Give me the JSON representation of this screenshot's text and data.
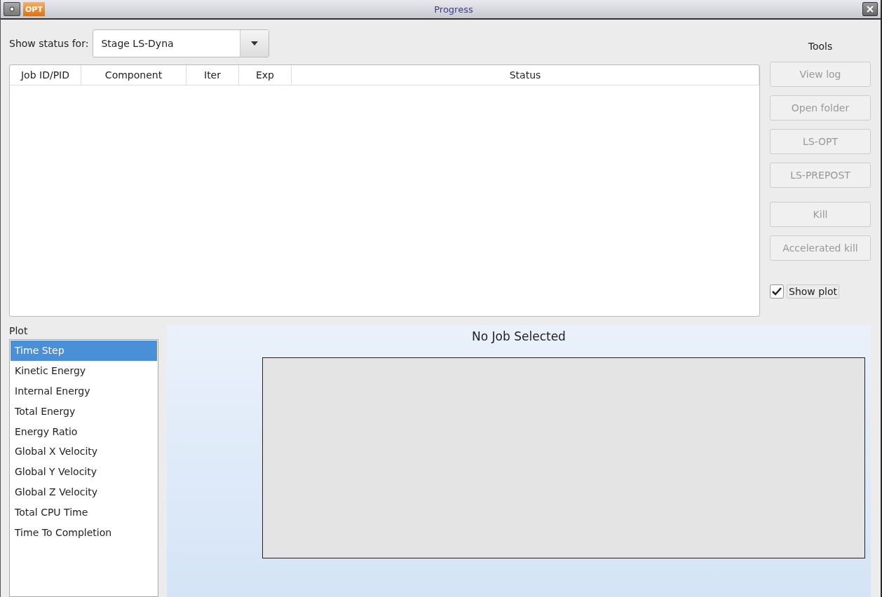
{
  "window": {
    "title": "Progress",
    "logo": "OPT"
  },
  "status_for": {
    "label": "Show status for:",
    "value": "Stage LS-Dyna"
  },
  "table": {
    "columns": [
      "Job ID/PID",
      "Component",
      "Iter",
      "Exp",
      "Status"
    ]
  },
  "tools": {
    "title": "Tools",
    "buttons": [
      {
        "label": "View log",
        "disabled": true
      },
      {
        "label": "Open folder",
        "disabled": true
      },
      {
        "label": "LS-OPT",
        "disabled": true
      },
      {
        "label": "LS-PREPOST",
        "disabled": true
      }
    ],
    "kill_buttons": [
      {
        "label": "Kill",
        "disabled": true
      },
      {
        "label": "Accelerated kill",
        "disabled": true
      }
    ],
    "show_plot": {
      "label": "Show plot",
      "checked": true
    }
  },
  "plot": {
    "label": "Plot",
    "items": [
      {
        "label": "Time Step",
        "selected": true
      },
      {
        "label": "Kinetic Energy",
        "selected": false
      },
      {
        "label": "Internal Energy",
        "selected": false
      },
      {
        "label": "Total Energy",
        "selected": false
      },
      {
        "label": "Energy Ratio",
        "selected": false
      },
      {
        "label": "Global X Velocity",
        "selected": false
      },
      {
        "label": "Global Y Velocity",
        "selected": false
      },
      {
        "label": "Global Z Velocity",
        "selected": false
      },
      {
        "label": "Total CPU Time",
        "selected": false
      },
      {
        "label": "Time To Completion",
        "selected": false
      }
    ],
    "title": "No Job Selected"
  }
}
